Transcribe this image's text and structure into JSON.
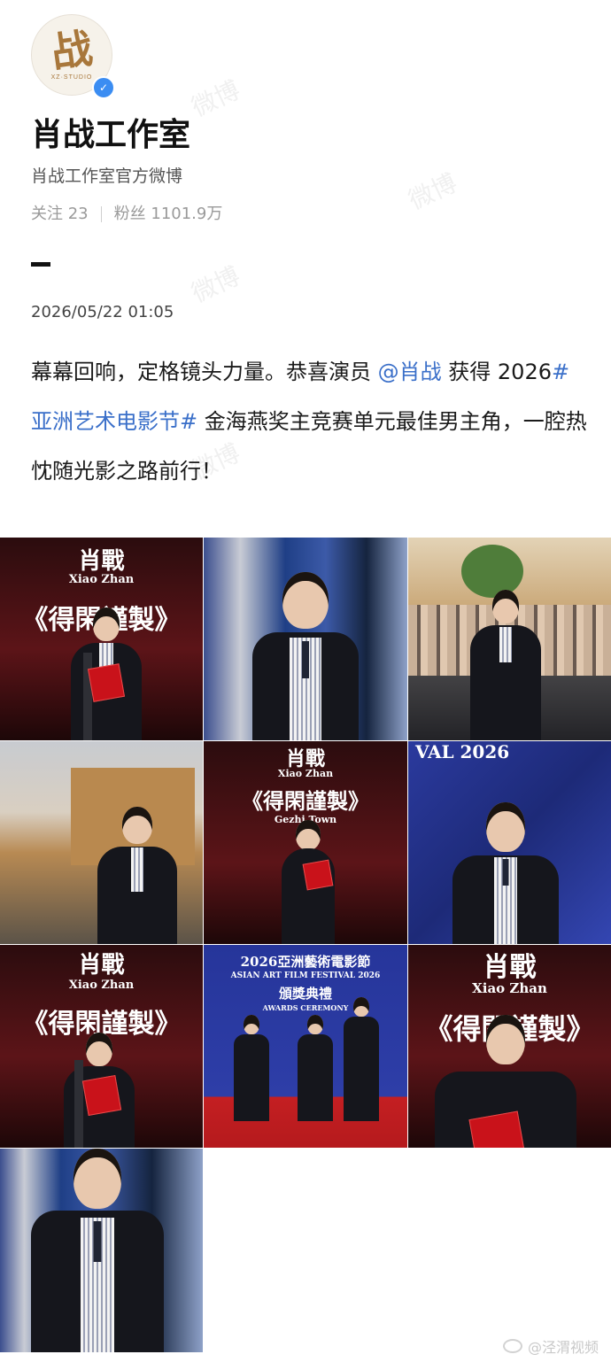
{
  "profile": {
    "avatar_text": "战",
    "avatar_subtext": "XZ·STUDIO",
    "name": "肖战工作室",
    "bio": "肖战工作室官方微博",
    "following_label": "关注",
    "following_count": "23",
    "followers_label": "粉丝",
    "followers_count": "1101.9万",
    "verified_icon": "verified-badge-icon"
  },
  "post": {
    "date": "2026/05/22 01:05",
    "text_1": "幕幕回响，定格镜头力量。恭喜演员",
    "mention": "@肖战",
    "text_2": "获得 2026",
    "hashtag": "#亚洲艺术电影节#",
    "text_3": "金海燕奖主竞赛单元最佳男主角，一腔热忱随光影之路前行！"
  },
  "images": {
    "caption_name": "肖戰",
    "caption_name_en": "Xiao Zhan",
    "caption_title": "《得閑謹製》",
    "caption_location": "Gezhi Town",
    "festival_banner": "VAL 2026",
    "festival_title_cn": "2026亞洲藝術電影節",
    "festival_title_en": "ASIAN ART FILM FESTIVAL 2026",
    "ceremony_cn": "頒獎典禮",
    "ceremony_en": "AWARDS CEREMONY"
  },
  "watermark": {
    "text": "@泾渭视频",
    "background_mark": "微博"
  },
  "colors": {
    "link": "#3a6fc9",
    "text": "#1a1a1a",
    "muted": "#9a9a9a",
    "stage_red": "#6a1518",
    "stage_blue": "#26359a"
  }
}
